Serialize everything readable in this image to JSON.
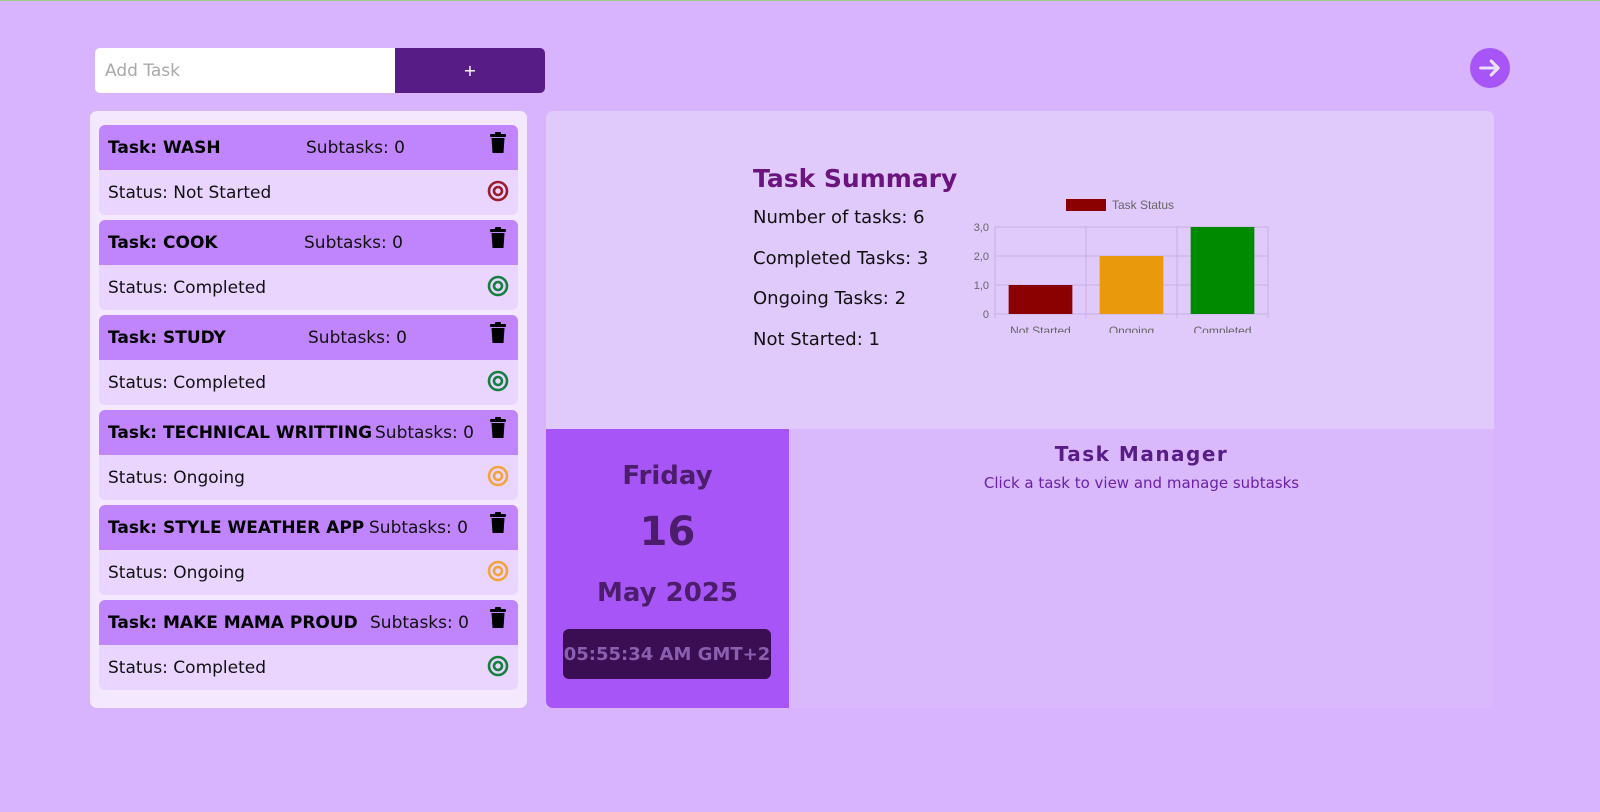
{
  "add_task": {
    "placeholder": "Add Task",
    "button_label": "+"
  },
  "tasks": [
    {
      "name": "Task: WASH",
      "subtasks": "Subtasks: 0",
      "status": "Status: Not Started",
      "status_color": "#9b1c2c"
    },
    {
      "name": "Task: COOK",
      "subtasks": "Subtasks: 0",
      "status": "Status: Completed",
      "status_color": "#15803d"
    },
    {
      "name": "Task: STUDY",
      "subtasks": "Subtasks: 0",
      "status": "Status: Completed",
      "status_color": "#15803d"
    },
    {
      "name": "Task: TECHNICAL WRITTING",
      "subtasks": "Subtasks: 0",
      "status": "Status: Ongoing",
      "status_color": "#f2a33a"
    },
    {
      "name": "Task: STYLE WEATHER APP",
      "subtasks": "Subtasks: 0",
      "status": "Status: Ongoing",
      "status_color": "#f2a33a"
    },
    {
      "name": "Task: MAKE MAMA PROUD",
      "subtasks": "Subtasks: 0",
      "status": "Status: Completed",
      "status_color": "#15803d"
    }
  ],
  "summary": {
    "title": "Task Summary",
    "total": "Number of tasks: 6",
    "completed": "Completed Tasks: 3",
    "ongoing": "Ongoing Tasks: 2",
    "not_started": "Not Started: 1"
  },
  "chart_data": {
    "type": "bar",
    "legend": "Task Status",
    "legend_position": "top",
    "categories": [
      "Not Started",
      "Ongoing",
      "Completed"
    ],
    "values": [
      1,
      2,
      3
    ],
    "colors": [
      "#8b0000",
      "#e89a0c",
      "#008a00"
    ],
    "yticks": [
      "0",
      "1,0",
      "2,0",
      "3,0"
    ],
    "ylim": [
      0,
      3
    ],
    "grid": true
  },
  "date": {
    "day_name": "Friday",
    "day_number": "16",
    "month_year": "May 2025",
    "time": "05:55:34 AM GMT+2"
  },
  "manager": {
    "title": "Task Manager",
    "subtitle": "Click a task to view and manage subtasks"
  },
  "icons": {
    "delete": "trash-icon",
    "status": "target-icon",
    "next": "arrow-right-icon"
  },
  "colors": {
    "accent": "#581c87",
    "background": "#d8b4fe",
    "panel_purple": "#a855f7"
  }
}
